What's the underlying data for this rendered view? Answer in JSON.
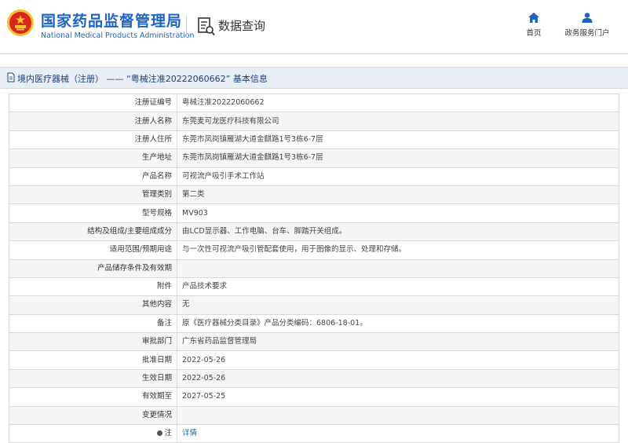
{
  "header": {
    "brand_cn": "国家药品监督管理局",
    "brand_en": "National Medical Products Administration",
    "query_title": "数据查询",
    "nav": [
      {
        "label": "首页",
        "icon": "home-icon"
      },
      {
        "label": "政务服务门户",
        "icon": "user-icon"
      }
    ]
  },
  "bar": {
    "title": "境内医疗器械（注册） —— “粤械注准20222060662” 基本信息"
  },
  "rows": [
    {
      "label": "注册证编号",
      "value": "粤械注准20222060662"
    },
    {
      "label": "注册人名称",
      "value": "东莞麦可龙医疗科技有限公司"
    },
    {
      "label": "注册人住所",
      "value": "东莞市凤岗镇雁湖大道金麒路1号3栋6-7层"
    },
    {
      "label": "生产地址",
      "value": "东莞市凤岗镇雁湖大道金麒路1号3栋6-7层"
    },
    {
      "label": "产品名称",
      "value": "可视流产吸引手术工作站"
    },
    {
      "label": "管理类别",
      "value": "第二类"
    },
    {
      "label": "型号规格",
      "value": "MV903"
    },
    {
      "label": "结构及组成/主要组成成分",
      "value": "由LCD显示器、工作电脑、台车、脚踏开关组成。"
    },
    {
      "label": "适用范围/预期用途",
      "value": "与一次性可视流产吸引管配套使用，用于图像的显示、处理和存储。"
    },
    {
      "label": "产品储存条件及有效期",
      "value": ""
    },
    {
      "label": "附件",
      "value": "产品技术要求"
    },
    {
      "label": "其他内容",
      "value": "无"
    },
    {
      "label": "备注",
      "value": "原《医疗器械分类目录》产品分类编码：6806-18-01。"
    },
    {
      "label": "审批部门",
      "value": "广东省药品监督管理局"
    },
    {
      "label": "批准日期",
      "value": "2022-05-26"
    },
    {
      "label": "生效日期",
      "value": "2022-05-26"
    },
    {
      "label": "有效期至",
      "value": "2027-05-25"
    },
    {
      "label": "变更情况",
      "value": ""
    },
    {
      "label": "注",
      "value": "详情"
    }
  ],
  "colors": {
    "brand_blue": "#1d64c2",
    "bar_bg": "#e8edf3",
    "emblem_red": "#d7261e",
    "emblem_gold": "#f2c230"
  }
}
